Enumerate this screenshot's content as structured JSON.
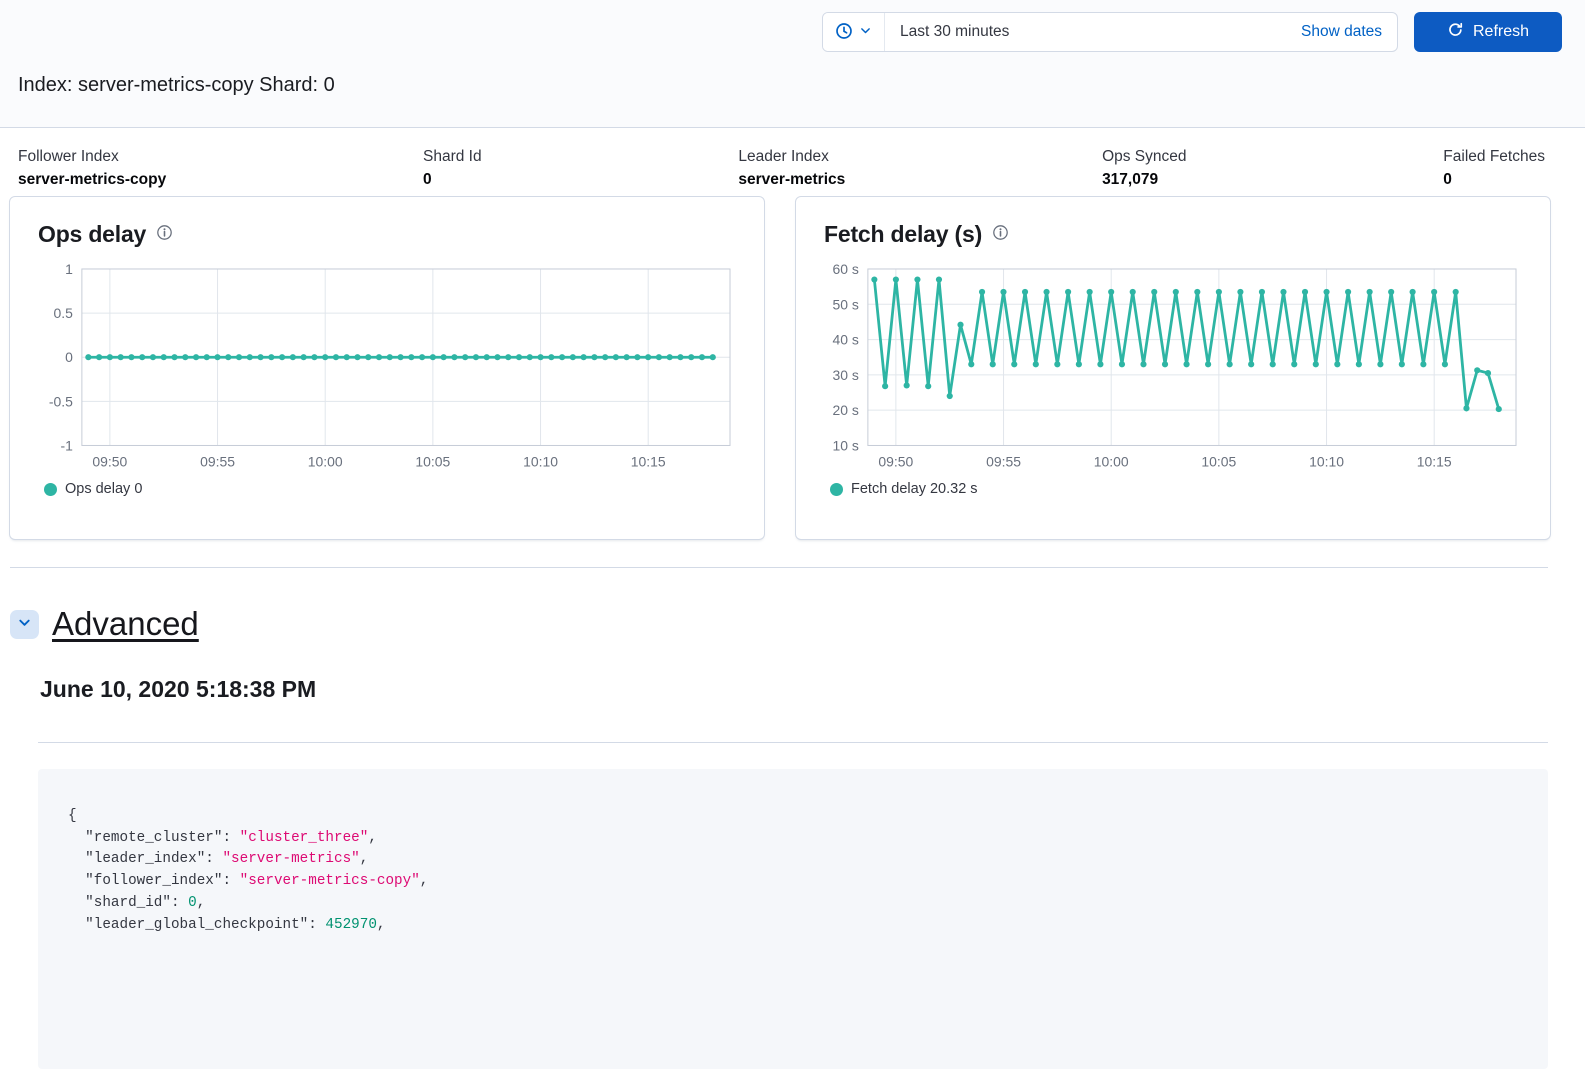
{
  "colors": {
    "primary_button": "#0d5bc2",
    "link_blue": "#0061c5",
    "series_teal": "#2eb5a4",
    "code_string": "#dd0a73",
    "code_number": "#009270",
    "divider": "#d3dae6",
    "header_bg": "#fafbfd",
    "code_bg": "#f5f7fa"
  },
  "time_picker": {
    "selected": "Last 30 minutes",
    "show_dates_label": "Show dates",
    "refresh_label": "Refresh"
  },
  "page": {
    "title": "Index: server-metrics-copy Shard: 0"
  },
  "stats": [
    {
      "label": "Follower Index",
      "value": "server-metrics-copy"
    },
    {
      "label": "Shard Id",
      "value": "0"
    },
    {
      "label": "Leader Index",
      "value": "server-metrics"
    },
    {
      "label": "Ops Synced",
      "value": "317,079"
    },
    {
      "label": "Failed Fetches",
      "value": "0"
    }
  ],
  "chart_data": [
    {
      "type": "line",
      "title": "Ops delay",
      "legend": "Ops delay 0",
      "color": "#2eb5a4",
      "ylim": [
        -1,
        1
      ],
      "y_ticks": [
        {
          "v": 1,
          "label": "1"
        },
        {
          "v": 0.5,
          "label": "0.5"
        },
        {
          "v": 0,
          "label": "0"
        },
        {
          "v": -0.5,
          "label": "-0.5"
        },
        {
          "v": -1,
          "label": "-1"
        }
      ],
      "x_tick_labels": [
        "09:50",
        "09:55",
        "10:00",
        "10:05",
        "10:10",
        "10:15"
      ],
      "x_tick_minutes": [
        1,
        6,
        11,
        16,
        21,
        26
      ],
      "x_domain_minutes": [
        -0.3,
        29.8
      ],
      "x_interval_s": 30,
      "grid": true,
      "legend_position": "bottom",
      "values": [
        0,
        0,
        0,
        0,
        0,
        0,
        0,
        0,
        0,
        0,
        0,
        0,
        0,
        0,
        0,
        0,
        0,
        0,
        0,
        0,
        0,
        0,
        0,
        0,
        0,
        0,
        0,
        0,
        0,
        0,
        0,
        0,
        0,
        0,
        0,
        0,
        0,
        0,
        0,
        0,
        0,
        0,
        0,
        0,
        0,
        0,
        0,
        0,
        0,
        0,
        0,
        0,
        0,
        0,
        0,
        0,
        0,
        0,
        0
      ]
    },
    {
      "type": "line",
      "title": "Fetch delay (s)",
      "legend": "Fetch delay 20.32 s",
      "color": "#2eb5a4",
      "ylim": [
        10,
        60
      ],
      "y_ticks": [
        {
          "v": 60,
          "label": "60 s"
        },
        {
          "v": 50,
          "label": "50 s"
        },
        {
          "v": 40,
          "label": "40 s"
        },
        {
          "v": 30,
          "label": "30 s"
        },
        {
          "v": 20,
          "label": "20 s"
        },
        {
          "v": 10,
          "label": "10 s"
        }
      ],
      "x_tick_labels": [
        "09:50",
        "09:55",
        "10:00",
        "10:05",
        "10:10",
        "10:15"
      ],
      "x_tick_minutes": [
        1,
        6,
        11,
        16,
        21,
        26
      ],
      "x_domain_minutes": [
        -0.3,
        29.8
      ],
      "x_interval_s": 30,
      "grid": true,
      "legend_position": "bottom",
      "values": [
        57,
        26.8,
        57,
        27,
        57,
        26.8,
        57,
        24,
        44.2,
        33,
        53.5,
        33,
        53.5,
        33,
        53.5,
        33,
        53.5,
        33,
        53.5,
        33,
        53.5,
        33,
        53.5,
        33,
        53.5,
        33,
        53.5,
        33,
        53.5,
        33,
        53.5,
        33,
        53.5,
        33,
        53.5,
        33,
        53.5,
        33,
        53.5,
        33,
        53.5,
        33,
        53.5,
        33,
        53.5,
        33,
        53.5,
        33,
        53.5,
        33,
        53.5,
        33,
        53.5,
        33,
        53.5,
        20.5,
        31.3,
        30.5,
        20.32
      ]
    }
  ],
  "advanced": {
    "label": "Advanced",
    "timestamp": "June 10, 2020 5:18:38 PM"
  },
  "code_block": {
    "lines": [
      [
        {
          "t": "{",
          "c": "p"
        }
      ],
      [
        {
          "t": "  ",
          "c": "p"
        },
        {
          "t": "\"remote_cluster\"",
          "c": "k"
        },
        {
          "t": ": ",
          "c": "p"
        },
        {
          "t": "\"cluster_three\"",
          "c": "s"
        },
        {
          "t": ",",
          "c": "p"
        }
      ],
      [
        {
          "t": "  ",
          "c": "p"
        },
        {
          "t": "\"leader_index\"",
          "c": "k"
        },
        {
          "t": ": ",
          "c": "p"
        },
        {
          "t": "\"server-metrics\"",
          "c": "s"
        },
        {
          "t": ",",
          "c": "p"
        }
      ],
      [
        {
          "t": "  ",
          "c": "p"
        },
        {
          "t": "\"follower_index\"",
          "c": "k"
        },
        {
          "t": ": ",
          "c": "p"
        },
        {
          "t": "\"server-metrics-copy\"",
          "c": "s"
        },
        {
          "t": ",",
          "c": "p"
        }
      ],
      [
        {
          "t": "  ",
          "c": "p"
        },
        {
          "t": "\"shard_id\"",
          "c": "k"
        },
        {
          "t": ": ",
          "c": "p"
        },
        {
          "t": "0",
          "c": "n"
        },
        {
          "t": ",",
          "c": "p"
        }
      ],
      [
        {
          "t": "  ",
          "c": "p"
        },
        {
          "t": "\"leader_global_checkpoint\"",
          "c": "k"
        },
        {
          "t": ": ",
          "c": "p"
        },
        {
          "t": "452970",
          "c": "n"
        },
        {
          "t": ",",
          "c": "p"
        }
      ]
    ]
  }
}
